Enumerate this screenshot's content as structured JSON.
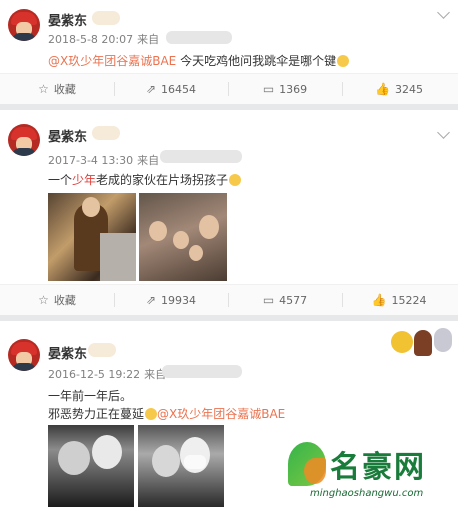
{
  "posts": [
    {
      "author": "晏紫东",
      "time": "2018-5-8 20:07",
      "source": "来自",
      "text_mention": "@X玖少年团谷嘉诚BAE",
      "text_rest": " 今天吃鸡他问我跳伞是哪个键",
      "actions": {
        "favorite": "收藏",
        "share": "16454",
        "comment": "1369",
        "like": "3245"
      }
    },
    {
      "author": "晏紫东",
      "time": "2017-3-4 13:30",
      "source": "来自",
      "text_pre": "一个",
      "text_red": "少年",
      "text_rest": "老成的家伙在片场拐孩子",
      "actions": {
        "favorite": "收藏",
        "share": "19934",
        "comment": "4577",
        "like": "15224"
      }
    },
    {
      "author": "晏紫东",
      "time": "2016-12-5 19:22",
      "source": "来自",
      "line1": "一年前一年后。",
      "line2_pre": "邪恶势力正在蔓延",
      "line2_mention": "@X玖少年团谷嘉诚BAE"
    }
  ],
  "icons": {
    "favorite": "star-icon",
    "share": "share-icon",
    "comment": "comment-icon",
    "like": "thumbs-up-icon",
    "menu": "chevron-down-icon"
  },
  "watermark": {
    "title": "名豪网",
    "url": "minghaoshangwu.com"
  },
  "colors": {
    "mention": "#eb7350",
    "highlight": "#e0413b",
    "meta": "#808080",
    "background": "#e7e8ea"
  }
}
